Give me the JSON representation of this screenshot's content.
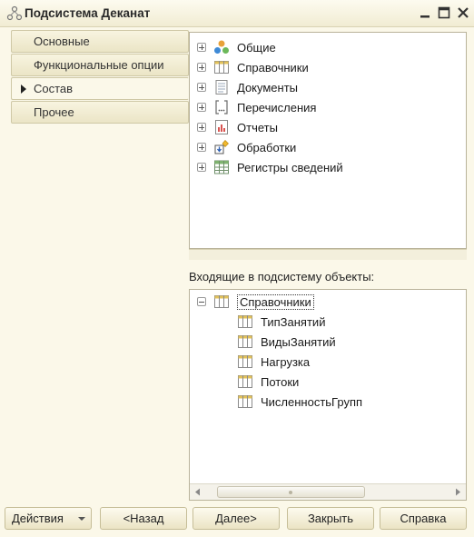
{
  "window": {
    "title": "Подсистема Деканат"
  },
  "tabs": [
    {
      "label": "Основные",
      "active": false
    },
    {
      "label": "Функциональные опции",
      "active": false
    },
    {
      "label": "Состав",
      "active": true
    },
    {
      "label": "Прочее",
      "active": false
    }
  ],
  "tree": {
    "items": [
      {
        "label": "Общие",
        "icon": "common-icon"
      },
      {
        "label": "Справочники",
        "icon": "catalogs-icon"
      },
      {
        "label": "Документы",
        "icon": "documents-icon"
      },
      {
        "label": "Перечисления",
        "icon": "enums-icon"
      },
      {
        "label": "Отчеты",
        "icon": "reports-icon"
      },
      {
        "label": "Обработки",
        "icon": "dataprocessors-icon"
      },
      {
        "label": "Регистры сведений",
        "icon": "registers-icon"
      }
    ]
  },
  "included": {
    "caption": "Входящие в подсистему объекты:",
    "group": {
      "label": "Справочники",
      "icon": "catalogs-icon"
    },
    "items": [
      {
        "label": "ТипЗанятий"
      },
      {
        "label": "ВидыЗанятий"
      },
      {
        "label": "Нагрузка"
      },
      {
        "label": "Потоки"
      },
      {
        "label": "ЧисленностьГрупп"
      }
    ]
  },
  "buttons": {
    "actions": "Действия",
    "back": "<Назад",
    "next": "Далее>",
    "close": "Закрыть",
    "help": "Справка"
  },
  "colors": {
    "background": "#fbf8e9",
    "border": "#b9b39a",
    "tab_gradient_bottom": "#ebe5c6"
  }
}
